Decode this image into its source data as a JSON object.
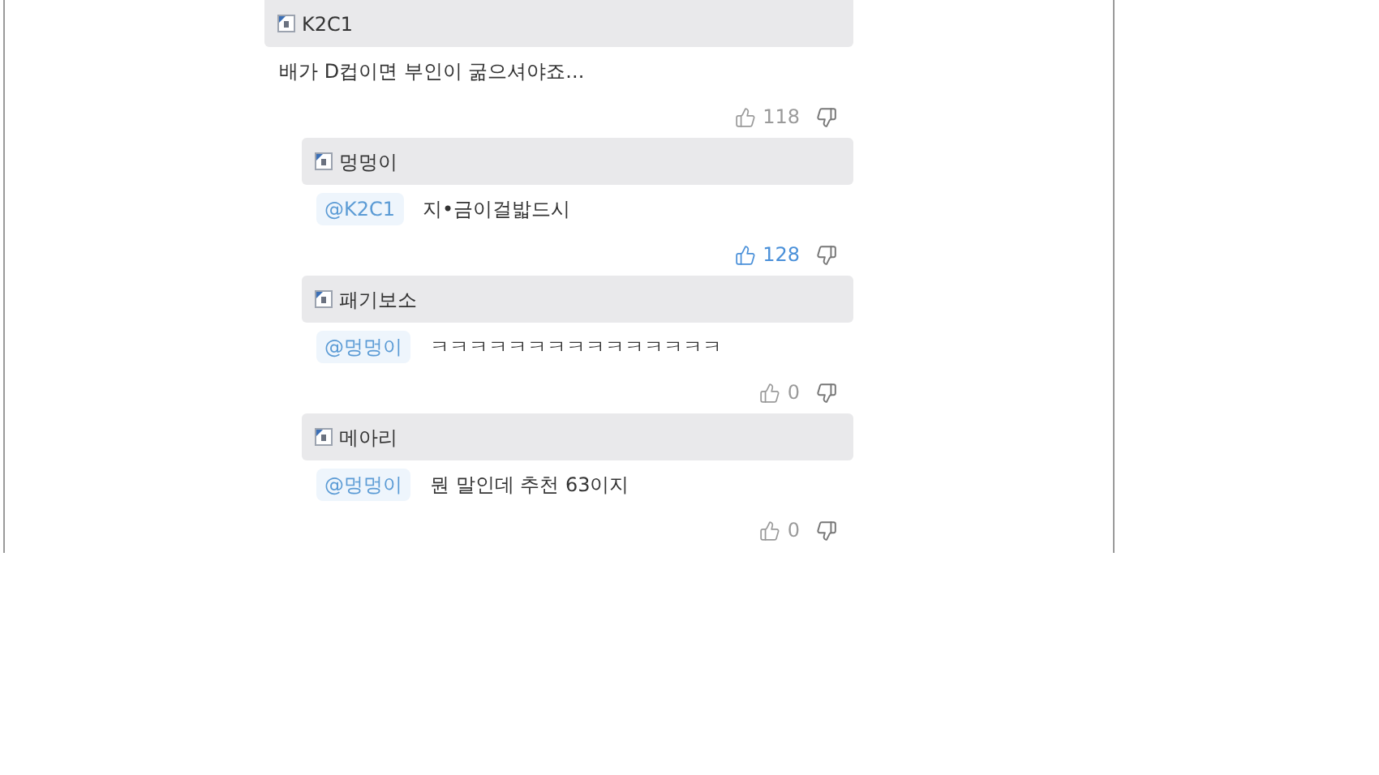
{
  "comments": [
    {
      "author": "K2C1",
      "text": "배가 D컵이면 부인이 굶으셔야죠...",
      "likes": "118",
      "liked": false,
      "replies": [
        {
          "author": "멍멍이",
          "mention": "@K2C1",
          "text": "지•금이걸밟드시",
          "likes": "128",
          "liked": true
        },
        {
          "author": "패기보소",
          "mention": "@멍멍이",
          "text": "ㅋㅋㅋㅋㅋㅋㅋㅋㅋㅋㅋㅋㅋㅋㅋ",
          "likes": "0",
          "liked": false
        },
        {
          "author": "메아리",
          "mention": "@멍멍이",
          "text": "뭔 말인데 추천 63이지",
          "likes": "0",
          "liked": false
        }
      ]
    }
  ]
}
